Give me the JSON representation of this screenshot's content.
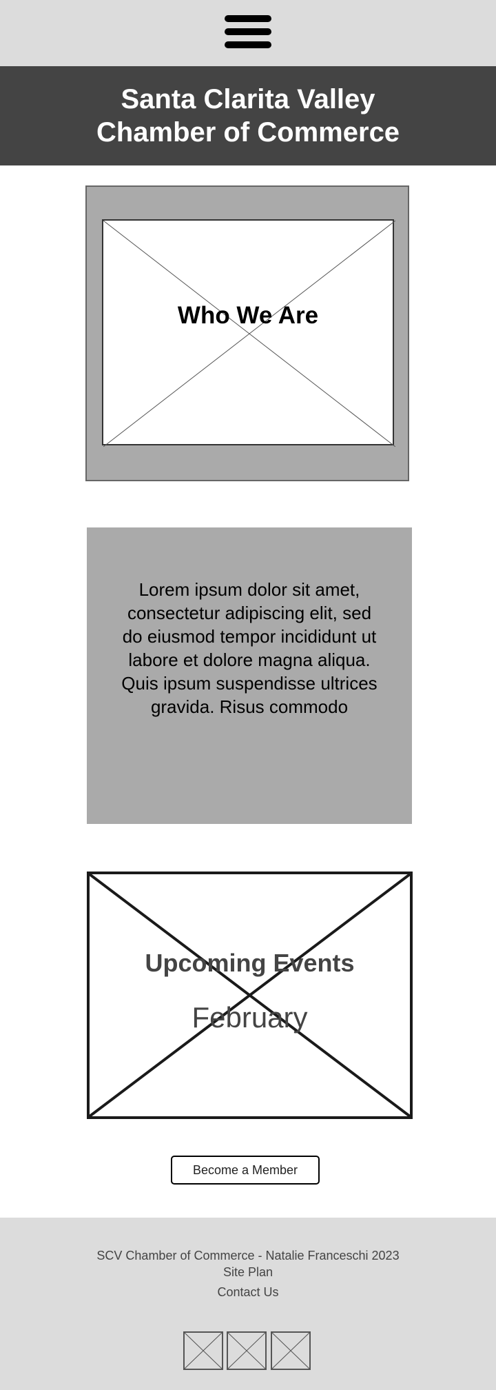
{
  "nav": {
    "menu_icon": "hamburger-menu-icon"
  },
  "header": {
    "title_line1": "Santa Clarita Valley",
    "title_line2": "Chamber of Commerce"
  },
  "who_we_are": {
    "title": "Who We Are",
    "image_icon": "image-placeholder-icon"
  },
  "intro": {
    "text": "Lorem ipsum dolor sit amet, consectetur adipiscing elit, sed do eiusmod tempor incididunt ut labore et dolore magna aliqua. Quis ipsum suspendisse ultrices gravida. Risus commodo"
  },
  "events": {
    "title": "Upcoming Events",
    "month": "February",
    "image_icon": "image-placeholder-icon"
  },
  "cta": {
    "member_label": "Become a Member"
  },
  "footer": {
    "copyright": "SCV Chamber of Commerce - Natalie Franceschi 2023",
    "site_plan": "Site Plan",
    "contact": "Contact Us",
    "social_icons": [
      "social-icon-placeholder",
      "social-icon-placeholder",
      "social-icon-placeholder"
    ]
  },
  "colors": {
    "topbar": "#dcdcdc",
    "header": "#444444",
    "panel": "#aaaaaa",
    "footer": "#dcdcdc"
  }
}
